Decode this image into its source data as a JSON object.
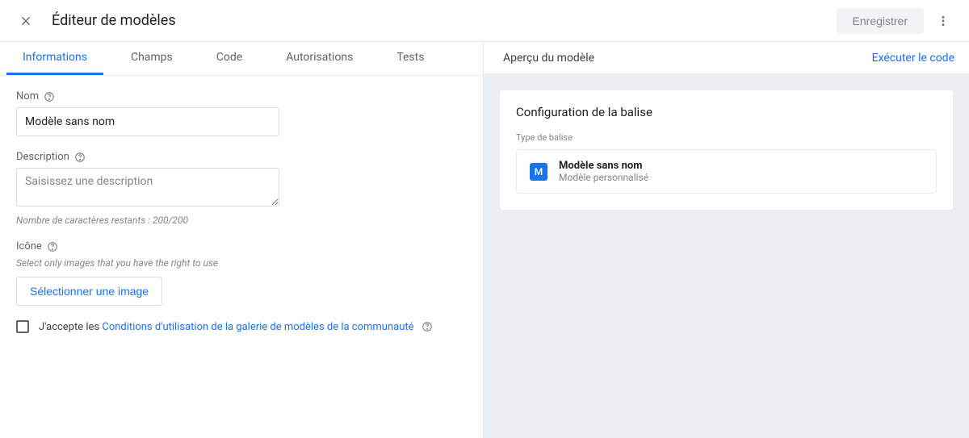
{
  "header": {
    "title": "Éditeur de modèles",
    "save_label": "Enregistrer"
  },
  "tabs": {
    "items": [
      {
        "label": "Informations"
      },
      {
        "label": "Champs"
      },
      {
        "label": "Code"
      },
      {
        "label": "Autorisations"
      },
      {
        "label": "Tests"
      }
    ]
  },
  "form": {
    "name_label": "Nom",
    "name_value": "Modèle sans nom",
    "description_label": "Description",
    "description_placeholder": "Saisissez une description",
    "chars_hint": "Nombre de caractères restants : 200/200",
    "icon_label": "Icône",
    "icon_hint": "Select only images that you have the right to use",
    "select_image_label": "Sélectionner une image",
    "accept_prefix": "J'accepte les ",
    "accept_link": "Conditions d'utilisation de la galerie de modèles de la communauté"
  },
  "preview": {
    "title": "Aperçu du modèle",
    "execute_label": "Exécuter le code",
    "config_title": "Configuration de la balise",
    "tag_type_label": "Type de balise",
    "tag_icon_letter": "M",
    "tag_name": "Modèle sans nom",
    "tag_subtitle": "Modèle personnalisé"
  }
}
